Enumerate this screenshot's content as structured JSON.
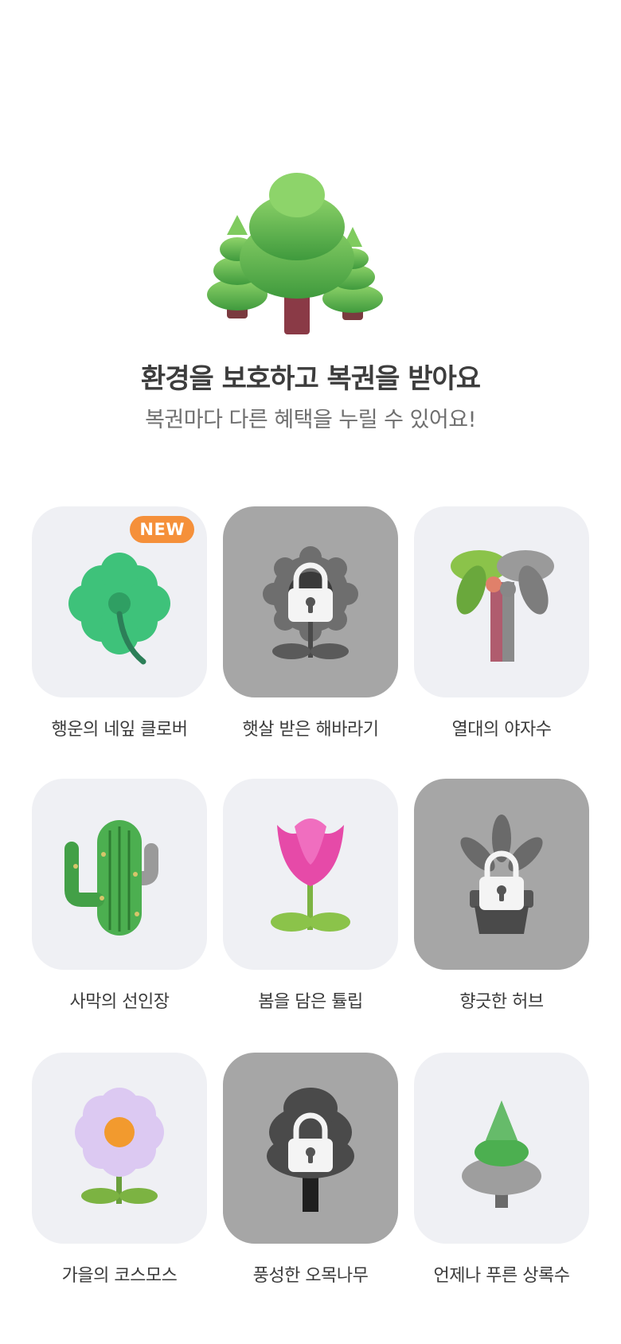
{
  "header": {
    "title": "환경을 보호하고 복권을 받아요",
    "subtitle": "복권마다 다른 혜택을 누릴 수 있어요!"
  },
  "badge": {
    "new_label": "NEW"
  },
  "items": [
    {
      "label": "행운의 네잎 클로버",
      "locked": false,
      "new": true,
      "icon": "four-leaf-clover-icon"
    },
    {
      "label": "햇살 받은 해바라기",
      "locked": true,
      "new": false,
      "icon": "sunflower-icon"
    },
    {
      "label": "열대의 야자수",
      "locked": false,
      "new": false,
      "icon": "palm-tree-icon"
    },
    {
      "label": "사막의 선인장",
      "locked": false,
      "new": false,
      "icon": "cactus-icon"
    },
    {
      "label": "봄을 담은 튤립",
      "locked": false,
      "new": false,
      "icon": "tulip-icon"
    },
    {
      "label": "향긋한 허브",
      "locked": true,
      "new": false,
      "icon": "herb-pot-icon"
    },
    {
      "label": "가을의 코스모스",
      "locked": false,
      "new": false,
      "icon": "cosmos-flower-icon"
    },
    {
      "label": "풍성한 오목나무",
      "locked": true,
      "new": false,
      "icon": "round-tree-icon"
    },
    {
      "label": "언제나 푸른 상록수",
      "locked": false,
      "new": false,
      "icon": "evergreen-tree-icon"
    }
  ]
}
